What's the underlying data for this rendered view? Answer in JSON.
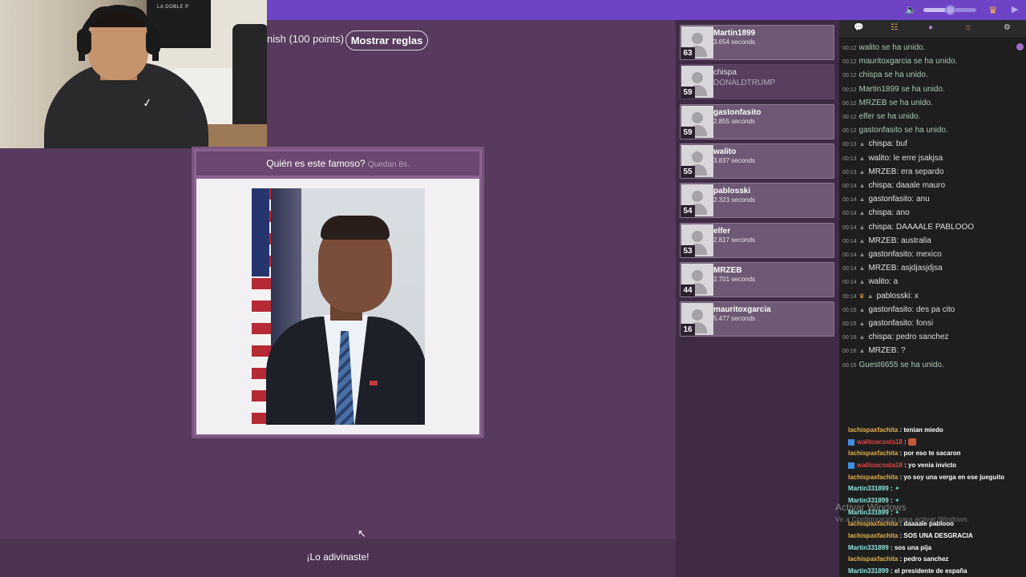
{
  "rules": {
    "text": "nish (100 points)",
    "button": "Mostrar reglas"
  },
  "question": {
    "prompt": "Quién es este famoso?",
    "time_left": "Quedan 8s."
  },
  "result": {
    "guessed": "¡Lo adivinaste!"
  },
  "webcam": {
    "flag_text": "LA DOBLE P"
  },
  "players": [
    {
      "name": "Martin1899",
      "time": "3.654 seconds",
      "score": "63",
      "dim": false
    },
    {
      "name": "chispa",
      "time": "DONALDTRUMP",
      "score": "59",
      "dim": true
    },
    {
      "name": "gastonfasito",
      "time": "2.855 seconds",
      "score": "59",
      "dim": false
    },
    {
      "name": "walito",
      "time": "3.837 seconds",
      "score": "55",
      "dim": false
    },
    {
      "name": "pablosski",
      "time": "2.323 seconds",
      "score": "54",
      "dim": false
    },
    {
      "name": "elfer",
      "time": "2.817 seconds",
      "score": "53",
      "dim": false
    },
    {
      "name": "MRZEB",
      "time": "2.701 seconds",
      "score": "44",
      "dim": false
    },
    {
      "name": "mauritoxgarcia",
      "time": "5.477 seconds",
      "score": "16",
      "dim": false
    }
  ],
  "chat": [
    {
      "ts": "00:12",
      "type": "join",
      "text": "walito se ha unido."
    },
    {
      "ts": "00:12",
      "type": "join",
      "text": "mauritoxgarcia se ha unido."
    },
    {
      "ts": "00:12",
      "type": "join",
      "text": "chispa se ha unido."
    },
    {
      "ts": "00:12",
      "type": "join",
      "text": "Martin1899 se ha unido."
    },
    {
      "ts": "00:12",
      "type": "join",
      "text": "MRZEB se ha unido."
    },
    {
      "ts": "00:12",
      "type": "join",
      "text": "elfer se ha unido."
    },
    {
      "ts": "00:12",
      "type": "join",
      "text": "gastonfasito se ha unido."
    },
    {
      "ts": "00:13",
      "type": "msg",
      "user": "chispa",
      "text": "buf"
    },
    {
      "ts": "00:13",
      "type": "msg",
      "user": "walito",
      "text": "le erre jsakjsa"
    },
    {
      "ts": "00:13",
      "type": "msg",
      "user": "MRZEB",
      "text": "era separdo"
    },
    {
      "ts": "00:14",
      "type": "msg",
      "user": "chispa",
      "text": "daaale mauro"
    },
    {
      "ts": "00:14",
      "type": "msg",
      "user": "gastonfasito",
      "text": "anu"
    },
    {
      "ts": "00:14",
      "type": "msg",
      "user": "chispa",
      "text": "ano"
    },
    {
      "ts": "00:14",
      "type": "msg",
      "user": "chispa",
      "text": "DAAAALE PABLOOO"
    },
    {
      "ts": "00:14",
      "type": "msg",
      "user": "MRZEB",
      "text": "australia"
    },
    {
      "ts": "00:14",
      "type": "msg",
      "user": "gastonfasito",
      "text": "mexico"
    },
    {
      "ts": "00:14",
      "type": "msg",
      "user": "MRZEB",
      "text": "asjdjasjdjsa"
    },
    {
      "ts": "00:14",
      "type": "msg",
      "user": "walito",
      "text": "a"
    },
    {
      "ts": "00:14",
      "type": "msg",
      "user": "pablosski",
      "text": "x",
      "crown": true
    },
    {
      "ts": "00:15",
      "type": "msg",
      "user": "gastonfasito",
      "text": "des pa cito"
    },
    {
      "ts": "00:15",
      "type": "msg",
      "user": "gastonfasito",
      "text": "fonsi"
    },
    {
      "ts": "00:16",
      "type": "msg",
      "user": "chispa",
      "text": "pedro sanchez"
    },
    {
      "ts": "00:16",
      "type": "msg",
      "user": "MRZEB",
      "text": "?"
    },
    {
      "ts": "00:16",
      "type": "join",
      "text": "Guest6655 se ha unido."
    }
  ],
  "stream_chat": [
    {
      "user": "lachispaxfachita",
      "color": "orange",
      "text": ": tenian miedo"
    },
    {
      "user": "walitoacosta18",
      "color": "red",
      "badge": true,
      "text": ":",
      "emote": true
    },
    {
      "user": "lachispaxfachita",
      "color": "orange",
      "text": ": por eso te sacaron"
    },
    {
      "user": "walitoacosta18",
      "color": "red",
      "badge": true,
      "text": ": yo venia invicto"
    },
    {
      "user": "lachispaxfachita",
      "color": "orange",
      "text": ": yo soy una verga en ese jueguito"
    },
    {
      "user": "Martin331899",
      "color": "teal",
      "text": ":",
      "sword": true
    },
    {
      "user": "Martin331899",
      "color": "teal",
      "text": ":",
      "sword": true
    },
    {
      "user": "Martin331899",
      "color": "teal",
      "text": ":",
      "sword": true
    },
    {
      "user": "lachispaxfachita",
      "color": "orange",
      "text": ": daaaale pablooo"
    },
    {
      "user": "lachispaxfachita",
      "color": "orange",
      "text": ": SOS UNA DESGRACIA"
    },
    {
      "user": "Martin331899",
      "color": "teal",
      "text": ": sos una pija"
    },
    {
      "user": "lachispaxfachita",
      "color": "orange",
      "text": ": pedro sanchez"
    },
    {
      "user": "Martin331899",
      "color": "teal",
      "text": ": el presidente de españa"
    }
  ],
  "watermark": {
    "title": "Activar Windows",
    "sub": "Ve a Configuración para activar Windows."
  },
  "volume": {
    "level": 0.5
  },
  "icons": [
    "volume-icon",
    "crown-icon",
    "play-icon",
    "chat-icon",
    "users-icon",
    "user-icon",
    "home-icon",
    "gear-icon"
  ]
}
